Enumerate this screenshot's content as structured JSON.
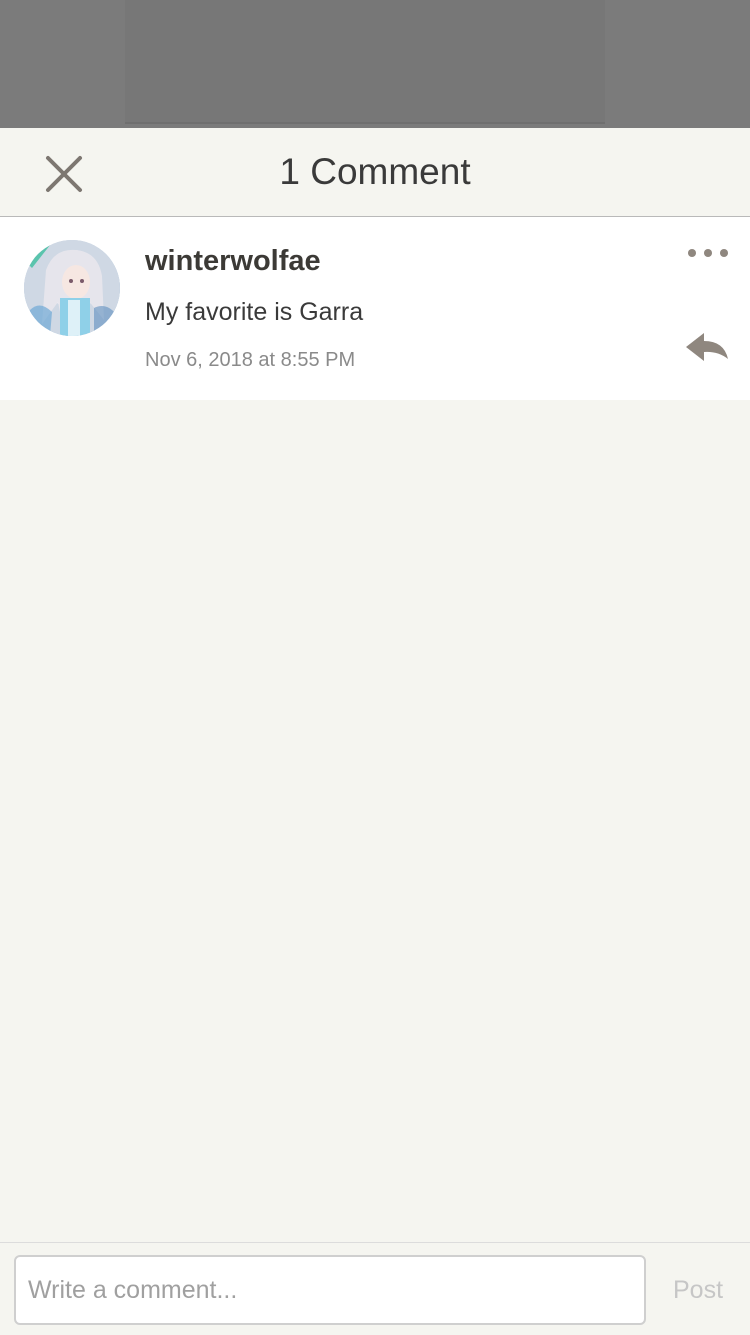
{
  "header": {
    "title": "1 Comment",
    "close_icon": "close-icon"
  },
  "comments": [
    {
      "username": "winterwolfae",
      "text": "My favorite is Garra",
      "timestamp": "Nov 6, 2018 at 8:55 PM",
      "avatar_icon": "user-avatar",
      "more_icon": "more-dots-icon",
      "reply_icon": "reply-arrow-icon"
    }
  ],
  "composer": {
    "placeholder": "Write a comment...",
    "value": "",
    "post_label": "Post"
  },
  "colors": {
    "backdrop": "#7b7b7b",
    "sheet_background": "#f5f5f0",
    "comment_background": "#ffffff",
    "icon_gray": "#8f877f",
    "post_disabled": "#c6c6c6"
  }
}
